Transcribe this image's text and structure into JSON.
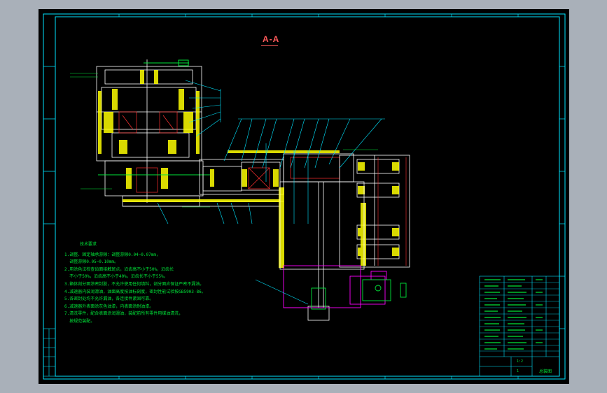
{
  "drawing": {
    "section_label": "A-A",
    "notes_title": "技术要求",
    "notes": [
      "1.调整、固定轴承游隙：调整游隙0.04~0.07mm，",
      "  调整游隙0.05~0.10mm。",
      "2.用涂色法检查齿面接触斑点，沿齿高不小于50%，沿齿长",
      "  不小于50%，沿齿高不小于40%，沿齿长不小于55%。",
      "3.箱体剖分面涂密封胶，不允许使用任何填料，剖分面应保证严密不漏油。",
      "4.减速器内装润滑油，油面高度按油标刻度，密封性能试验按GB5903-86。",
      "5.各密封处均不允许漏油，各连接件紧固可靠。",
      "6.减速器外表面涂灰色油漆，内表面涂耐油漆。",
      "7.清洗零件，配合表面涂润滑油，装配前所有零件用煤油清洗，",
      "  按规范装配。"
    ],
    "title_block": {
      "drawing_name": "总装图",
      "scale": "1:2",
      "sheet": "1"
    },
    "colors": {
      "background": "#000000",
      "frame": "#00e5ff",
      "outline": "#ffffff",
      "hatch": "#ffff00",
      "dimension": "#00e5ff",
      "text": "#00e639",
      "magenta": "#ff00ff",
      "red": "#ff3030"
    }
  }
}
